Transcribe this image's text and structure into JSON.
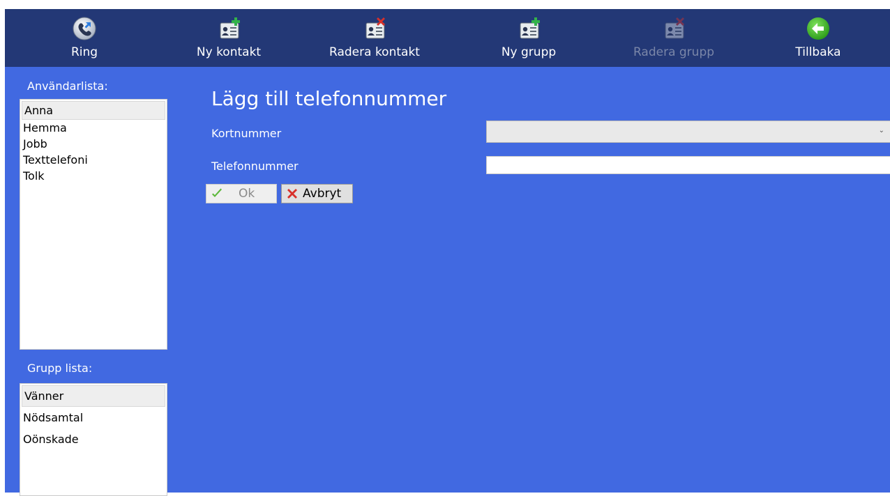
{
  "toolbar": {
    "items": [
      {
        "label": "Ring",
        "icon": "phone-icon",
        "enabled": true
      },
      {
        "label": "Ny kontakt",
        "icon": "add-contact-icon",
        "enabled": true
      },
      {
        "label": "Radera kontakt",
        "icon": "delete-contact-icon",
        "enabled": true
      },
      {
        "label": "Ny grupp",
        "icon": "add-group-icon",
        "enabled": true
      },
      {
        "label": "Radera grupp",
        "icon": "delete-group-icon",
        "enabled": false
      },
      {
        "label": "Tillbaka",
        "icon": "back-arrow-icon",
        "enabled": true
      }
    ]
  },
  "sidebar": {
    "users_heading": "Användarlista:",
    "users_header": "Anna",
    "users_items": [
      "Hemma",
      "Jobb",
      "Texttelefoni",
      "Tolk"
    ],
    "groups_heading": "Grupp lista:",
    "groups_header": "Vänner",
    "groups_items": [
      "Nödsamtal",
      "Oönskade"
    ]
  },
  "form": {
    "title": "Lägg till telefonnummer",
    "kortnummer_label": "Kortnummer",
    "kortnummer_value": "",
    "telefonnummer_label": "Telefonnummer",
    "telefonnummer_value": "",
    "ok_label": "Ok",
    "cancel_label": "Avbryt"
  },
  "colors": {
    "toolbar_bg": "#233876",
    "main_bg": "#4169e1",
    "disabled_text": "#7a86a8"
  }
}
